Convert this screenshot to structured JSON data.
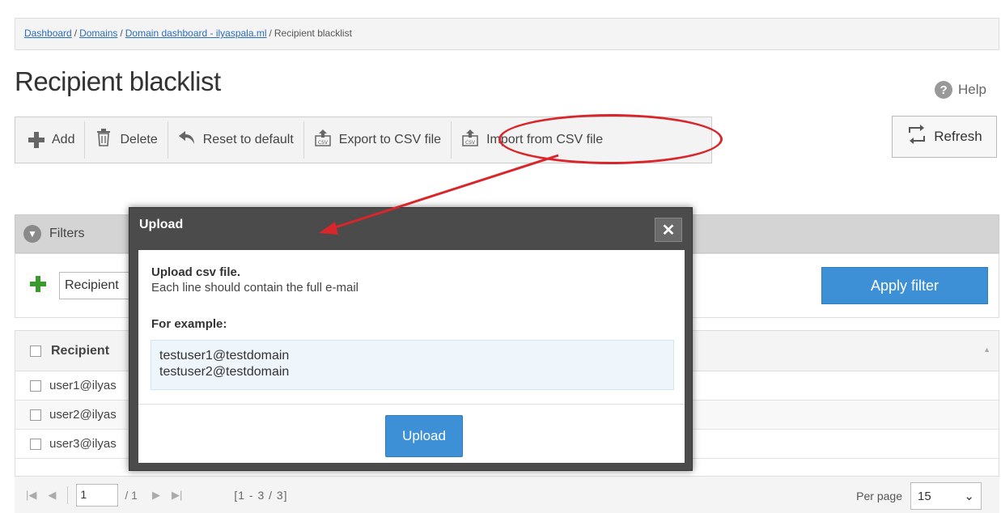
{
  "breadcrumb": {
    "items": [
      "Dashboard",
      "Domains",
      "Domain dashboard - ilyaspala.ml"
    ],
    "separator": "/",
    "current": "Recipient blacklist"
  },
  "page_title": "Recipient blacklist",
  "help_label": "Help",
  "help_icon": "?",
  "toolbar": {
    "add": "Add",
    "delete": "Delete",
    "reset": "Reset to default",
    "export": "Export to CSV file",
    "import": "Import from CSV file",
    "refresh": "Refresh"
  },
  "filters": {
    "label": "Filters",
    "field_value": "Recipient",
    "apply_label": "Apply filter"
  },
  "grid": {
    "column_header": "Recipient",
    "rows": [
      "user1@ilyas",
      "user2@ilyas",
      "user3@ilyas"
    ]
  },
  "pager": {
    "page_value": "1",
    "of_total": "/ 1",
    "range": "[1 - 3 / 3]",
    "per_page_label": "Per page",
    "per_page_value": "15"
  },
  "modal": {
    "title": "Upload",
    "close_glyph": "✕",
    "heading": "Upload csv file.",
    "description": "Each line should contain the full e-mail",
    "example_label": "For example:",
    "example_lines": [
      "testuser1@testdomain",
      "testuser2@testdomain"
    ],
    "upload_label": "Upload"
  },
  "colors": {
    "accent_blue": "#3d8fd6",
    "callout_red": "#d8262b",
    "add_green": "#3a9a30"
  }
}
